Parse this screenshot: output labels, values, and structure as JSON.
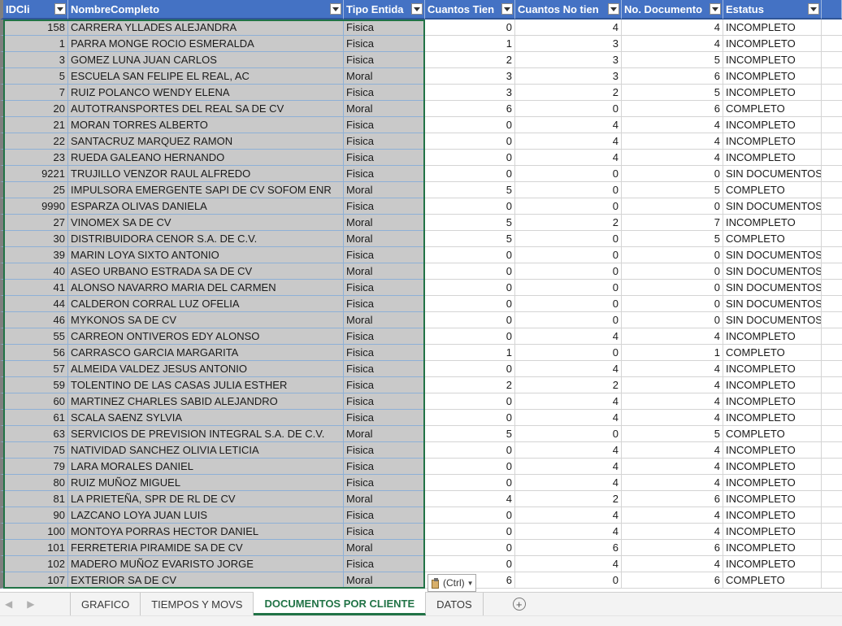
{
  "table": {
    "headers": [
      "IDCli",
      "NombreCompleto",
      "Tipo Entida",
      "Cuantos Tien",
      "Cuantos No tien",
      "No. Documento",
      "Estatus"
    ],
    "rows": [
      [
        "158",
        "CARRERA YLLADES ALEJANDRA",
        "Fisica",
        "0",
        "4",
        "4",
        "INCOMPLETO"
      ],
      [
        "1",
        "PARRA MONGE ROCIO ESMERALDA",
        "Fisica",
        "1",
        "3",
        "4",
        "INCOMPLETO"
      ],
      [
        "3",
        "GOMEZ LUNA JUAN CARLOS",
        "Fisica",
        "2",
        "3",
        "5",
        "INCOMPLETO"
      ],
      [
        "5",
        "ESCUELA SAN FELIPE EL REAL, AC",
        "Moral",
        "3",
        "3",
        "6",
        "INCOMPLETO"
      ],
      [
        "7",
        "RUIZ POLANCO WENDY ELENA",
        "Fisica",
        "3",
        "2",
        "5",
        "INCOMPLETO"
      ],
      [
        "20",
        "AUTOTRANSPORTES DEL REAL SA DE CV",
        "Moral",
        "6",
        "0",
        "6",
        "COMPLETO"
      ],
      [
        "21",
        "MORAN TORRES ALBERTO",
        "Fisica",
        "0",
        "4",
        "4",
        "INCOMPLETO"
      ],
      [
        "22",
        "SANTACRUZ MARQUEZ RAMON",
        "Fisica",
        "0",
        "4",
        "4",
        "INCOMPLETO"
      ],
      [
        "23",
        "RUEDA GALEANO HERNANDO",
        "Fisica",
        "0",
        "4",
        "4",
        "INCOMPLETO"
      ],
      [
        "9221",
        "TRUJILLO VENZOR RAUL ALFREDO",
        "Fisica",
        "0",
        "0",
        "0",
        "SIN DOCUMENTOS"
      ],
      [
        "25",
        "IMPULSORA EMERGENTE SAPI DE CV SOFOM ENR",
        "Moral",
        "5",
        "0",
        "5",
        "COMPLETO"
      ],
      [
        "9990",
        "ESPARZA OLIVAS DANIELA",
        "Fisica",
        "0",
        "0",
        "0",
        "SIN DOCUMENTOS"
      ],
      [
        "27",
        "VINOMEX SA DE CV",
        "Moral",
        "5",
        "2",
        "7",
        "INCOMPLETO"
      ],
      [
        "30",
        "DISTRIBUIDORA CENOR S.A. DE C.V.",
        "Moral",
        "5",
        "0",
        "5",
        "COMPLETO"
      ],
      [
        "39",
        "MARIN LOYA SIXTO ANTONIO",
        "Fisica",
        "0",
        "0",
        "0",
        "SIN DOCUMENTOS"
      ],
      [
        "40",
        "ASEO URBANO ESTRADA SA DE CV",
        "Moral",
        "0",
        "0",
        "0",
        "SIN DOCUMENTOS"
      ],
      [
        "41",
        "ALONSO NAVARRO MARIA DEL CARMEN",
        "Fisica",
        "0",
        "0",
        "0",
        "SIN DOCUMENTOS"
      ],
      [
        "44",
        "CALDERON CORRAL LUZ OFELIA",
        "Fisica",
        "0",
        "0",
        "0",
        "SIN DOCUMENTOS"
      ],
      [
        "46",
        "MYKONOS SA DE CV",
        "Moral",
        "0",
        "0",
        "0",
        "SIN DOCUMENTOS"
      ],
      [
        "55",
        "CARREON ONTIVEROS EDY ALONSO",
        "Fisica",
        "0",
        "4",
        "4",
        "INCOMPLETO"
      ],
      [
        "56",
        "CARRASCO GARCIA MARGARITA",
        "Fisica",
        "1",
        "0",
        "1",
        "COMPLETO"
      ],
      [
        "57",
        "ALMEIDA VALDEZ JESUS ANTONIO",
        "Fisica",
        "0",
        "4",
        "4",
        "INCOMPLETO"
      ],
      [
        "59",
        "TOLENTINO DE LAS CASAS JULIA ESTHER",
        "Fisica",
        "2",
        "2",
        "4",
        "INCOMPLETO"
      ],
      [
        "60",
        "MARTINEZ CHARLES SABID ALEJANDRO",
        "Fisica",
        "0",
        "4",
        "4",
        "INCOMPLETO"
      ],
      [
        "61",
        "SCALA SAENZ SYLVIA",
        "Fisica",
        "0",
        "4",
        "4",
        "INCOMPLETO"
      ],
      [
        "63",
        "SERVICIOS DE PREVISION INTEGRAL S.A. DE C.V.",
        "Moral",
        "5",
        "0",
        "5",
        "COMPLETO"
      ],
      [
        "75",
        "NATIVIDAD SANCHEZ OLIVIA LETICIA",
        "Fisica",
        "0",
        "4",
        "4",
        "INCOMPLETO"
      ],
      [
        "79",
        "LARA MORALES DANIEL",
        "Fisica",
        "0",
        "4",
        "4",
        "INCOMPLETO"
      ],
      [
        "80",
        "RUIZ MUÑOZ MIGUEL",
        "Fisica",
        "0",
        "4",
        "4",
        "INCOMPLETO"
      ],
      [
        "81",
        "LA PRIETEÑA, SPR DE RL DE CV",
        "Moral",
        "4",
        "2",
        "6",
        "INCOMPLETO"
      ],
      [
        "90",
        "LAZCANO LOYA JUAN LUIS",
        "Fisica",
        "0",
        "4",
        "4",
        "INCOMPLETO"
      ],
      [
        "100",
        "MONTOYA PORRAS HECTOR DANIEL",
        "Fisica",
        "0",
        "4",
        "4",
        "INCOMPLETO"
      ],
      [
        "101",
        "FERRETERIA PIRAMIDE SA DE CV",
        "Moral",
        "0",
        "6",
        "6",
        "INCOMPLETO"
      ],
      [
        "102",
        "MADERO MUÑOZ EVARISTO JORGE",
        "Fisica",
        "0",
        "4",
        "4",
        "INCOMPLETO"
      ],
      [
        "107",
        "EXTERIOR SA DE CV",
        "Moral",
        "6",
        "0",
        "6",
        "COMPLETO"
      ]
    ]
  },
  "paste_options": {
    "label": "(Ctrl)",
    "icon": "clipboard-icon"
  },
  "sheets": {
    "tabs": [
      "GRAFICO",
      "TIEMPOS Y MOVS",
      "DOCUMENTOS POR CLIENTE",
      "DATOS"
    ],
    "active": "DOCUMENTOS POR CLIENTE",
    "nav_prev": "◀",
    "nav_next": "▶",
    "add_label": "+"
  },
  "colors": {
    "header_bg": "#4472c4",
    "selected_fill": "#c9c9c9",
    "active_tab": "#217346"
  }
}
